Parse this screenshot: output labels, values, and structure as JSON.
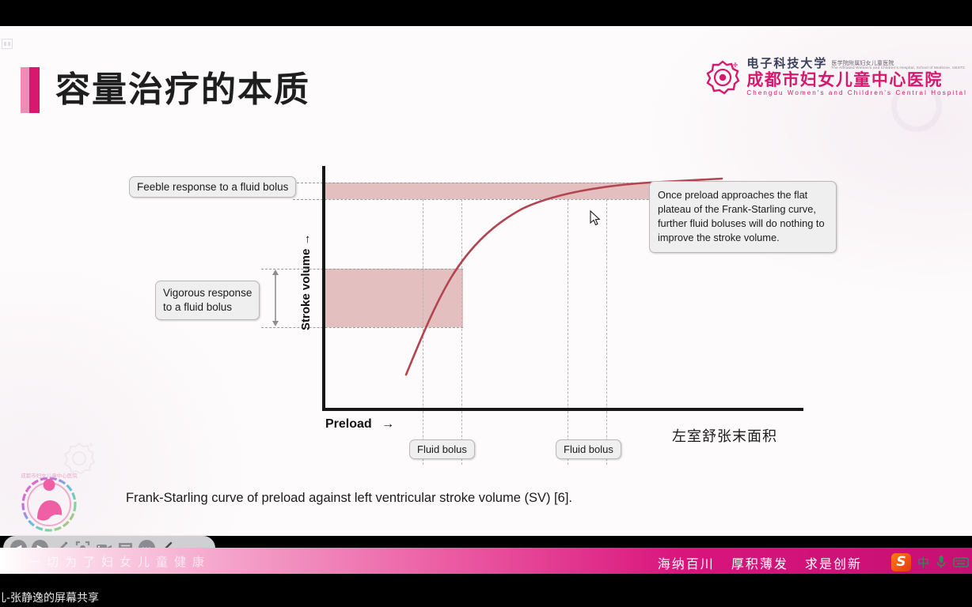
{
  "slide": {
    "title": "容量治疗的本质",
    "caption": "Frank-Starling curve of preload against left ventricular stroke volume (SV) [6].",
    "cn_axis_label": "左室舒张末面积"
  },
  "logo": {
    "cn_line1": "电子科技大学",
    "cn_line1_sub": "医学院附属妇女儿童医院",
    "en_line1_sub": "The Affiliated Women's and Children's Hospital, School of Medicine, UESTC",
    "cn_line2": "成都市妇女儿童中心医院",
    "en_line2": "Chengdu Women's and Children's Central Hospital"
  },
  "chart_data": {
    "type": "line",
    "title": "Frank-Starling curve",
    "xlabel": "Preload",
    "ylabel": "Stroke volume",
    "xlim": [
      0,
      100
    ],
    "ylim": [
      0,
      100
    ],
    "grid": false,
    "legend": "none",
    "series": [
      {
        "name": "Frank-Starling curve",
        "color": "#b2454f",
        "x": [
          17,
          22,
          28,
          34,
          40,
          46,
          52,
          58,
          64,
          70,
          76,
          82,
          88,
          94,
          99
        ],
        "y": [
          6,
          18,
          32,
          44,
          54,
          62,
          69,
          75,
          80,
          84,
          87,
          90,
          92,
          93.5,
          94.5
        ]
      }
    ],
    "bands": [
      {
        "name": "feeble-response-band",
        "label": "Feeble response to a fluid bolus",
        "y_low": 87,
        "y_high": 94,
        "color": "#d9a7a8",
        "x_extent": [
          0,
          82
        ]
      },
      {
        "name": "vigorous-response-band",
        "label": "Vigorous response to a fluid bolus",
        "y_low": 33,
        "y_high": 57,
        "color": "#d9a7a8",
        "x_extent": [
          0,
          29
        ]
      }
    ],
    "bolus_markers": [
      {
        "label": "Fluid bolus",
        "x_start": 21,
        "x_end": 29
      },
      {
        "label": "Fluid bolus",
        "x_start": 51,
        "x_end": 59
      }
    ],
    "annotations": [
      {
        "name": "feeble-callout",
        "text": "Feeble response to a fluid bolus"
      },
      {
        "name": "vigorous-callout",
        "text": "Vigorous response\nto a fluid bolus"
      },
      {
        "name": "plateau-callout",
        "text": "Once preload approaches the flat plateau of the Frank-Starling curve, further fluid boluses will do nothing to improve the stroke volume."
      }
    ]
  },
  "callouts": {
    "feeble": "Feeble response to a fluid bolus",
    "vigorous_line1": "Vigorous response",
    "vigorous_line2": "to a fluid bolus",
    "plateau": "Once preload approaches the flat plateau of the Frank-Starling curve, further fluid boluses will do nothing to improve the stroke volume.",
    "fluid_bolus_1": "Fluid bolus",
    "fluid_bolus_2": "Fluid bolus"
  },
  "axes": {
    "y_label": "Stroke volume",
    "y_arrow": "→",
    "x_label": "Preload",
    "x_arrow": "→"
  },
  "toolbar": {
    "items": [
      {
        "name": "prev-slide-button",
        "icon": "left-arrow-icon",
        "glyph": "◀"
      },
      {
        "name": "play-button",
        "icon": "play-icon",
        "glyph": "▶"
      },
      {
        "name": "annotate-button",
        "icon": "pencil-icon",
        "glyph": "✏"
      },
      {
        "name": "screenshot-button",
        "icon": "crosshair-icon",
        "glyph": "⊡"
      },
      {
        "name": "video-button",
        "icon": "video-camera-icon",
        "glyph": "▭"
      },
      {
        "name": "comment-button",
        "icon": "chat-bubble-icon",
        "glyph": "▤"
      },
      {
        "name": "more-button",
        "icon": "ellipsis-icon",
        "glyph": "•••"
      },
      {
        "name": "collapse-button",
        "icon": "chevron-left-icon",
        "glyph": "❮"
      }
    ]
  },
  "banner": {
    "left_slogan": "一切为了妇女儿童健康",
    "right_mottos": [
      "海纳百川",
      "厚积薄发",
      "求是创新"
    ]
  },
  "ime": {
    "brand": "S",
    "mode": "中",
    "mic": "🎤",
    "keyboard": "⌨"
  },
  "status": {
    "share_text": "儿-张静逸的屏幕共享"
  },
  "colors": {
    "accent_pink": "#d6186f",
    "light_pink": "#ef8bb4",
    "curve_red": "#b2454f",
    "band_red": "#d9a7a8"
  }
}
